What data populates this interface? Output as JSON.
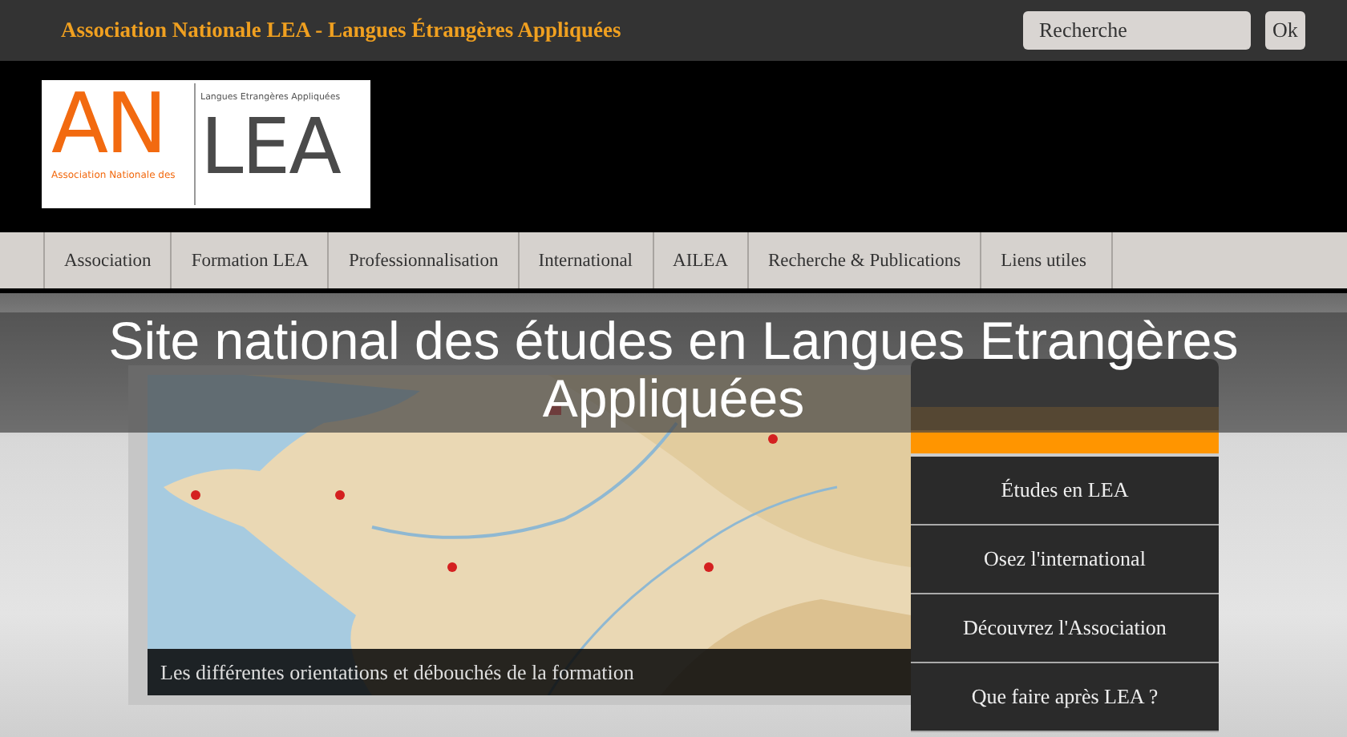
{
  "top_bar": {
    "title": "Association Nationale LEA - Langues Étrangères Appliquées",
    "search": {
      "placeholder": "Recherche"
    },
    "submit": "Ok"
  },
  "logo": {
    "initials": "AN",
    "subtitle": "Association Nationale des",
    "tagline": "Langues Etrangères Appliquées",
    "acronym": "LEA"
  },
  "nav": [
    {
      "label": "Association"
    },
    {
      "label": "Formation LEA"
    },
    {
      "label": "Professionnalisation"
    },
    {
      "label": "International"
    },
    {
      "label": "AILEA"
    },
    {
      "label": "Recherche & Publications"
    },
    {
      "label": "Liens utiles"
    }
  ],
  "headline": "Site national des études en Langues Etrangères Appliquées",
  "slideshow": {
    "caption": "Les différentes orientations et débouchés de la formation"
  },
  "side_menu": [
    {
      "label": "Études en LEA"
    },
    {
      "label": "Osez l'international"
    },
    {
      "label": "Découvrez l'Association"
    },
    {
      "label": "Que faire après LEA ?"
    }
  ]
}
